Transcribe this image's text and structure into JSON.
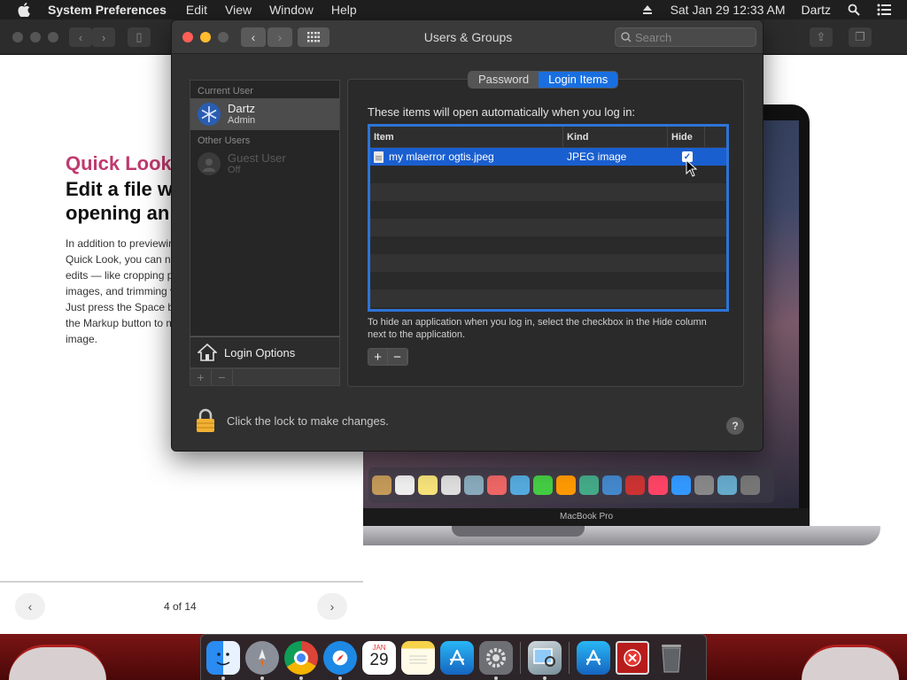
{
  "menubar": {
    "app_name": "System Preferences",
    "menus": [
      "Edit",
      "View",
      "Window",
      "Help"
    ],
    "clock": "Sat Jan 29  12:33 AM",
    "user": "Dartz"
  },
  "preview": {
    "kicker": "Quick Look",
    "heading": "Edit a file without opening an app",
    "body": "In addition to previewing files with Quick Look, you can now make quick edits — like cropping photos, rotating images, and trimming video clips. Just press the Space bar, then click the Markup button to mark up an image.",
    "page_counter": "4 of 14",
    "macbook_label": "MacBook Pro"
  },
  "window": {
    "title": "Users & Groups",
    "search_placeholder": "Search"
  },
  "sidebar": {
    "current_user_header": "Current User",
    "current_user": {
      "name": "Dartz",
      "role": "Admin"
    },
    "other_users_header": "Other Users",
    "guest_user": {
      "name": "Guest User",
      "role": "Off"
    },
    "login_options": "Login Options"
  },
  "tabs": [
    {
      "label": "Password",
      "active": false
    },
    {
      "label": "Login Items",
      "active": true
    }
  ],
  "login_items": {
    "caption": "These items will open automatically when you log in:",
    "columns": {
      "item": "Item",
      "kind": "Kind",
      "hide": "Hide"
    },
    "rows": [
      {
        "item": "my mlaerror ogtis.jpeg",
        "kind": "JPEG image",
        "hide": true
      }
    ],
    "hint": "To hide an application when you log in, select the checkbox in the Hide column next to the application.",
    "add": "+",
    "remove": "−"
  },
  "footer": {
    "lock_text": "Click the lock to make changes.",
    "help": "?"
  },
  "colors": {
    "selection_blue": "#1a5fd0",
    "tab_active": "#1a6fe0",
    "kicker_pink": "#c0396e",
    "close_red": "#fe5f57",
    "minimize_yellow": "#febc2e"
  },
  "dock_icons": [
    "finder-icon",
    "launchpad-icon",
    "chrome-icon",
    "safari-icon",
    "calendar-icon",
    "notes-icon",
    "app-store-icon",
    "system-preferences-icon",
    "preview-icon",
    "app-store-icon",
    "close-app-icon",
    "trash-icon"
  ],
  "dock_calendar": {
    "month": "JAN",
    "day": "29"
  }
}
